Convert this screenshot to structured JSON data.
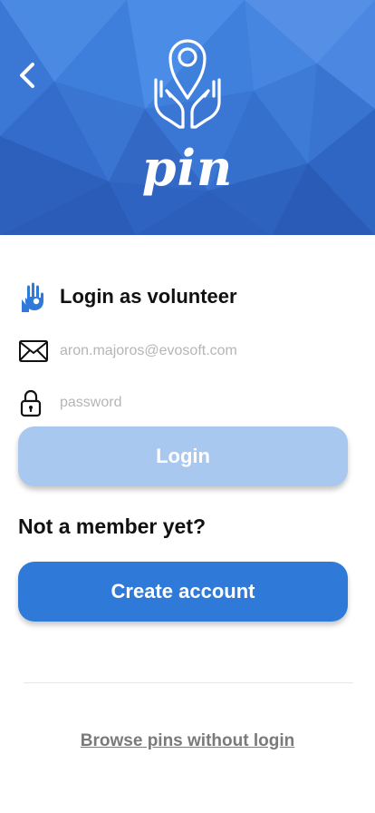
{
  "header": {
    "back_icon": "chevron-left-icon",
    "logo_icon": "location-pin-in-hands-icon",
    "logo_text": "pin",
    "background_color": "#3a78d6"
  },
  "login": {
    "icon": "volunteer-hand-icon",
    "title": "Login as volunteer",
    "email_icon": "envelope-icon",
    "email_placeholder": "aron.majoros@evosoft.com",
    "password_icon": "padlock-icon",
    "password_placeholder": "password",
    "login_button": "Login"
  },
  "signup": {
    "prompt": "Not a member yet?",
    "create_button": "Create account"
  },
  "footer": {
    "browse_link": "Browse pins without login"
  },
  "colors": {
    "primary": "#2f7ad9",
    "primary_disabled": "#a9c8ef",
    "text": "#111111",
    "link": "#7a7a7a"
  }
}
